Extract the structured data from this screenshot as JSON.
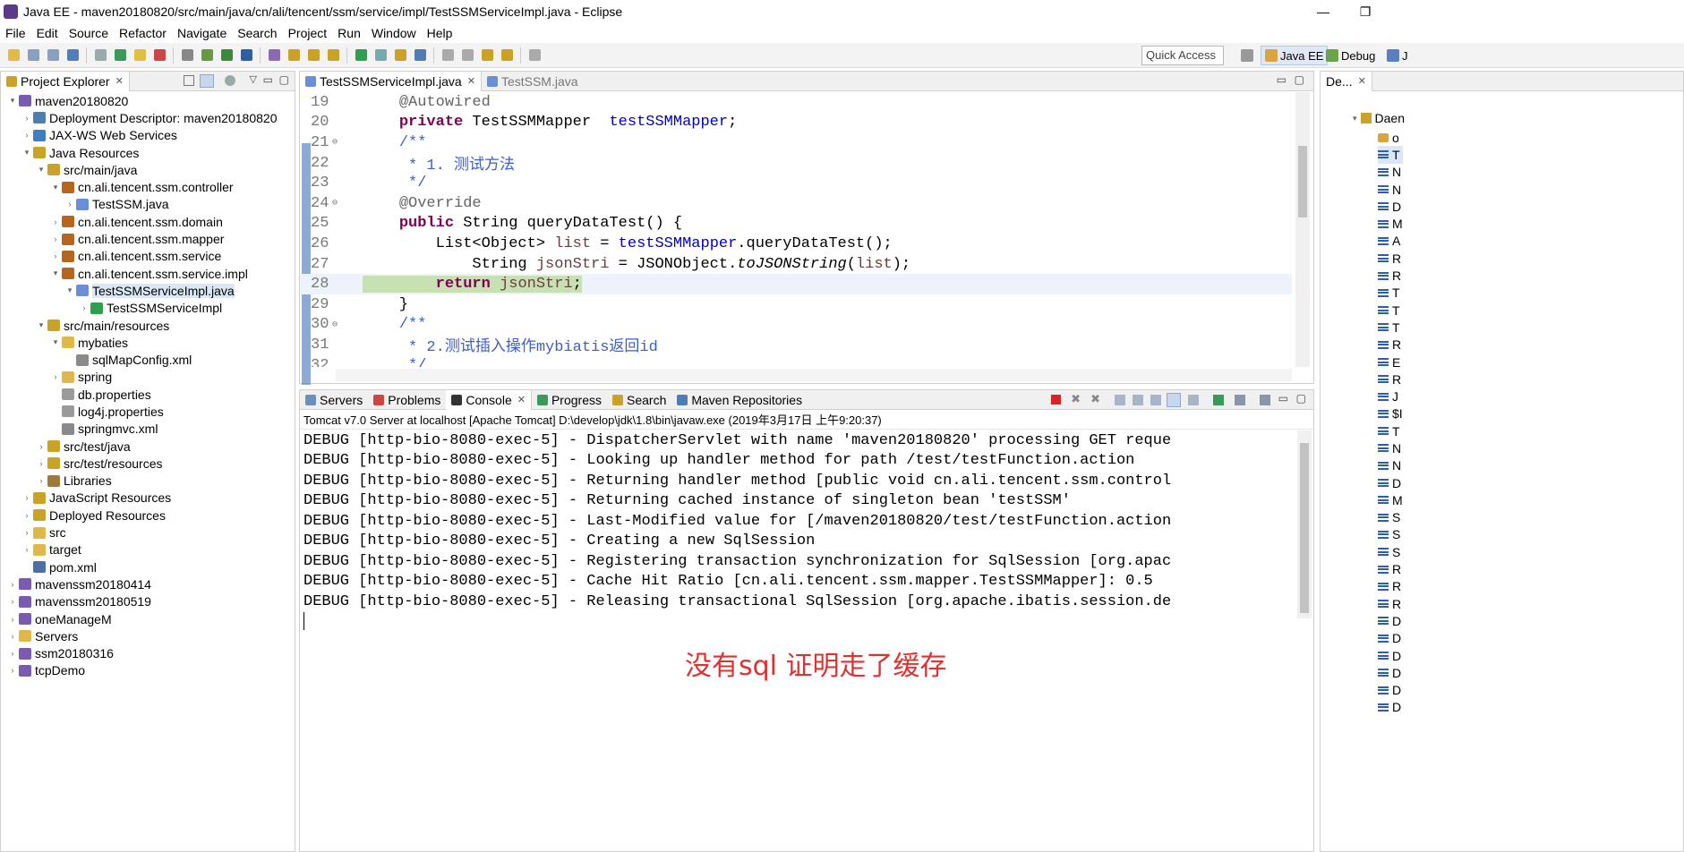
{
  "window": {
    "title": "Java EE - maven20180820/src/main/java/cn/ali/tencent/ssm/service/impl/TestSSMServiceImpl.java - Eclipse",
    "minimize": "—",
    "maximize": "❐"
  },
  "menu": [
    "File",
    "Edit",
    "Source",
    "Refactor",
    "Navigate",
    "Search",
    "Project",
    "Run",
    "Window",
    "Help"
  ],
  "toolbar": {
    "quick_access": "Quick Access",
    "perspectives": [
      {
        "label": "Java EE",
        "active": true
      },
      {
        "label": "Debug",
        "active": false
      },
      {
        "label": "J",
        "active": false
      }
    ]
  },
  "project_explorer": {
    "tab_label": "Project Explorer",
    "rows": [
      {
        "label": "maven20180820",
        "level": 0,
        "arrow": "▾",
        "icon": "project-icon",
        "color": "#7a5bb0"
      },
      {
        "label": "Deployment Descriptor: maven20180820",
        "level": 1,
        "arrow": "›",
        "icon": "descriptor-icon",
        "color": "#4d7db3"
      },
      {
        "label": "JAX-WS Web Services",
        "level": 1,
        "arrow": "›",
        "icon": "webservice-icon",
        "color": "#3f7fbf"
      },
      {
        "label": "Java Resources",
        "level": 1,
        "arrow": "▾",
        "icon": "java-resources-icon",
        "color": "#c9a227"
      },
      {
        "label": "src/main/java",
        "level": 2,
        "arrow": "▾",
        "icon": "source-folder-icon",
        "color": "#c9a227"
      },
      {
        "label": "cn.ali.tencent.ssm.controller",
        "level": 3,
        "arrow": "▾",
        "icon": "package-icon",
        "color": "#b5651d"
      },
      {
        "label": "TestSSM.java",
        "level": 4,
        "arrow": "›",
        "icon": "java-file-icon",
        "color": "#6b8fd6"
      },
      {
        "label": "cn.ali.tencent.ssm.domain",
        "level": 3,
        "arrow": "›",
        "icon": "package-icon",
        "color": "#b5651d"
      },
      {
        "label": "cn.ali.tencent.ssm.mapper",
        "level": 3,
        "arrow": "›",
        "icon": "package-icon",
        "color": "#b5651d"
      },
      {
        "label": "cn.ali.tencent.ssm.service",
        "level": 3,
        "arrow": "›",
        "icon": "package-icon",
        "color": "#b5651d"
      },
      {
        "label": "cn.ali.tencent.ssm.service.impl",
        "level": 3,
        "arrow": "▾",
        "icon": "package-icon",
        "color": "#b5651d"
      },
      {
        "label": "TestSSMServiceImpl.java",
        "level": 4,
        "arrow": "▾",
        "icon": "java-file-icon",
        "color": "#6b8fd6",
        "selected": true
      },
      {
        "label": "TestSSMServiceImpl",
        "level": 5,
        "arrow": "›",
        "icon": "class-icon",
        "color": "#2e9e4f"
      },
      {
        "label": "src/main/resources",
        "level": 2,
        "arrow": "▾",
        "icon": "source-folder-icon",
        "color": "#c9a227"
      },
      {
        "label": "mybaties",
        "level": 3,
        "arrow": "▾",
        "icon": "folder-icon",
        "color": "#e0b84a"
      },
      {
        "label": "sqlMapConfig.xml",
        "level": 4,
        "arrow": "",
        "icon": "xml-file-icon",
        "color": "#8a8a8a"
      },
      {
        "label": "spring",
        "level": 3,
        "arrow": "›",
        "icon": "folder-icon",
        "color": "#e0b84a"
      },
      {
        "label": "db.properties",
        "level": 3,
        "arrow": "",
        "icon": "file-icon",
        "color": "#9a9a9a"
      },
      {
        "label": "log4j.properties",
        "level": 3,
        "arrow": "",
        "icon": "file-icon",
        "color": "#9a9a9a"
      },
      {
        "label": "springmvc.xml",
        "level": 3,
        "arrow": "",
        "icon": "xml-file-icon",
        "color": "#8a8a8a"
      },
      {
        "label": "src/test/java",
        "level": 2,
        "arrow": "›",
        "icon": "source-folder-icon",
        "color": "#c9a227"
      },
      {
        "label": "src/test/resources",
        "level": 2,
        "arrow": "›",
        "icon": "source-folder-icon",
        "color": "#c9a227"
      },
      {
        "label": "Libraries",
        "level": 2,
        "arrow": "›",
        "icon": "library-icon",
        "color": "#a07a3a"
      },
      {
        "label": "JavaScript Resources",
        "level": 1,
        "arrow": "›",
        "icon": "js-resources-icon",
        "color": "#c9a227"
      },
      {
        "label": "Deployed Resources",
        "level": 1,
        "arrow": "›",
        "icon": "deployed-icon",
        "color": "#c9a227"
      },
      {
        "label": "src",
        "level": 1,
        "arrow": "›",
        "icon": "folder-icon",
        "color": "#e0b84a"
      },
      {
        "label": "target",
        "level": 1,
        "arrow": "›",
        "icon": "folder-icon",
        "color": "#e0b84a"
      },
      {
        "label": "pom.xml",
        "level": 1,
        "arrow": "",
        "icon": "pom-file-icon",
        "color": "#4d6fa8"
      },
      {
        "label": "mavenssm20180414",
        "level": 0,
        "arrow": "›",
        "icon": "project-icon",
        "color": "#7a5bb0"
      },
      {
        "label": "mavenssm20180519",
        "level": 0,
        "arrow": "›",
        "icon": "project-icon",
        "color": "#7a5bb0"
      },
      {
        "label": "oneManageM",
        "level": 0,
        "arrow": "›",
        "icon": "project-icon",
        "color": "#7a5bb0"
      },
      {
        "label": "Servers",
        "level": 0,
        "arrow": "›",
        "icon": "servers-folder-icon",
        "color": "#e0b84a"
      },
      {
        "label": "ssm20180316",
        "level": 0,
        "arrow": "›",
        "icon": "project-icon",
        "color": "#7a5bb0"
      },
      {
        "label": "tcpDemo",
        "level": 0,
        "arrow": "›",
        "icon": "project-icon",
        "color": "#7a5bb0"
      }
    ]
  },
  "editor": {
    "tabs": [
      {
        "label": "TestSSMServiceImpl.java",
        "active": true
      },
      {
        "label": "TestSSM.java",
        "active": false
      }
    ],
    "lines": [
      {
        "n": "19",
        "fold": "",
        "parts": [
          {
            "t": "    ",
            "c": ""
          },
          {
            "t": "@Autowired",
            "c": "ann"
          }
        ]
      },
      {
        "n": "20",
        "fold": "",
        "parts": [
          {
            "t": "    ",
            "c": ""
          },
          {
            "t": "private",
            "c": "kw"
          },
          {
            "t": " TestSSMMapper  ",
            "c": ""
          },
          {
            "t": "testSSMMapper",
            "c": "fld"
          },
          {
            "t": ";",
            "c": ""
          }
        ]
      },
      {
        "n": "21",
        "fold": "⊖",
        "parts": [
          {
            "t": "    ",
            "c": ""
          },
          {
            "t": "/**",
            "c": "cm"
          }
        ]
      },
      {
        "n": "22",
        "fold": "",
        "parts": [
          {
            "t": "     ",
            "c": ""
          },
          {
            "t": "* 1. 测试方法",
            "c": "cm"
          }
        ]
      },
      {
        "n": "23",
        "fold": "",
        "parts": [
          {
            "t": "     ",
            "c": ""
          },
          {
            "t": "*/",
            "c": "cm"
          }
        ]
      },
      {
        "n": "24",
        "fold": "⊖",
        "parts": [
          {
            "t": "    ",
            "c": ""
          },
          {
            "t": "@Override",
            "c": "ann"
          }
        ]
      },
      {
        "n": "25",
        "fold": "",
        "parts": [
          {
            "t": "    ",
            "c": ""
          },
          {
            "t": "public",
            "c": "kw"
          },
          {
            "t": " String queryDataTest() {",
            "c": ""
          }
        ]
      },
      {
        "n": "26",
        "fold": "",
        "parts": [
          {
            "t": "        List<Object> ",
            "c": ""
          },
          {
            "t": "list",
            "c": "var"
          },
          {
            "t": " = ",
            "c": ""
          },
          {
            "t": "testSSMMapper",
            "c": "fld"
          },
          {
            "t": ".queryDataTest();",
            "c": ""
          }
        ]
      },
      {
        "n": "27",
        "fold": "",
        "parts": [
          {
            "t": "            String ",
            "c": ""
          },
          {
            "t": "jsonStri",
            "c": "var"
          },
          {
            "t": " = JSONObject.",
            "c": ""
          },
          {
            "t": "toJSONString",
            "c": "it"
          },
          {
            "t": "(",
            "c": ""
          },
          {
            "t": "list",
            "c": "var"
          },
          {
            "t": ");",
            "c": ""
          }
        ]
      },
      {
        "n": "28",
        "fold": "",
        "current": true,
        "parts": [
          {
            "t": "        ",
            "c": ""
          },
          {
            "t": "return",
            "c": "kw"
          },
          {
            "t": " ",
            "c": ""
          },
          {
            "t": "jsonStri",
            "c": "var"
          },
          {
            "t": ";",
            "c": ""
          }
        ]
      },
      {
        "n": "29",
        "fold": "",
        "parts": [
          {
            "t": "    }",
            "c": ""
          }
        ]
      },
      {
        "n": "30",
        "fold": "⊖",
        "parts": [
          {
            "t": "    ",
            "c": ""
          },
          {
            "t": "/**",
            "c": "cm"
          }
        ]
      },
      {
        "n": "31",
        "fold": "",
        "parts": [
          {
            "t": "     ",
            "c": ""
          },
          {
            "t": "* 2.测试插入操作mybiatis返回id",
            "c": "cm"
          }
        ]
      },
      {
        "n": "32",
        "fold": "",
        "parts": [
          {
            "t": "     ",
            "c": ""
          },
          {
            "t": "*/",
            "c": "cm"
          }
        ]
      }
    ]
  },
  "console": {
    "tabs": [
      {
        "label": "Servers",
        "icon": "servers-icon",
        "active": false
      },
      {
        "label": "Problems",
        "icon": "problems-icon",
        "active": false
      },
      {
        "label": "Console",
        "icon": "console-icon",
        "active": true
      },
      {
        "label": "Progress",
        "icon": "progress-icon",
        "active": false
      },
      {
        "label": "Search",
        "icon": "search-icon",
        "active": false
      },
      {
        "label": "Maven Repositories",
        "icon": "maven-icon",
        "active": false
      }
    ],
    "header": "Tomcat v7.0 Server at localhost [Apache Tomcat] D:\\develop\\jdk\\1.8\\bin\\javaw.exe (2019年3月17日 上午9:20:37)",
    "lines": [
      "DEBUG [http-bio-8080-exec-5] - DispatcherServlet with name 'maven20180820' processing GET reque",
      "DEBUG [http-bio-8080-exec-5] - Looking up handler method for path /test/testFunction.action",
      "DEBUG [http-bio-8080-exec-5] - Returning handler method [public void cn.ali.tencent.ssm.control",
      "DEBUG [http-bio-8080-exec-5] - Returning cached instance of singleton bean 'testSSM'",
      "DEBUG [http-bio-8080-exec-5] - Last-Modified value for [/maven20180820/test/testFunction.action",
      "DEBUG [http-bio-8080-exec-5] - Creating a new SqlSession",
      "DEBUG [http-bio-8080-exec-5] - Registering transaction synchronization for SqlSession [org.apac",
      "DEBUG [http-bio-8080-exec-5] - Cache Hit Ratio [cn.ali.tencent.ssm.mapper.TestSSMMapper]: 0.5",
      "DEBUG [http-bio-8080-exec-5] - Releasing transactional SqlSession [org.apache.ibatis.session.de"
    ],
    "annotation": "没有sql  证明走了缓存"
  },
  "right_panel": {
    "tab_label": "De...",
    "root_label": "Daen",
    "rows": [
      "o",
      "T",
      "N",
      "N",
      "D",
      "M",
      "A",
      "R",
      "R",
      "T",
      "T",
      "T",
      "R",
      "E",
      "R",
      "J",
      "$I",
      "T",
      "N",
      "N",
      "D",
      "M",
      "S",
      "S",
      "S",
      "R",
      "R",
      "R",
      "D",
      "D",
      "D",
      "D",
      "D",
      "D"
    ]
  },
  "colors": {
    "keyword": "#7f0055",
    "annotation": "#646464",
    "comment": "#3f5fbf",
    "field": "#0000c0",
    "local_var": "#6a3e3e",
    "current_line": "#c7e1b2",
    "annotation_text": "#e03030"
  }
}
